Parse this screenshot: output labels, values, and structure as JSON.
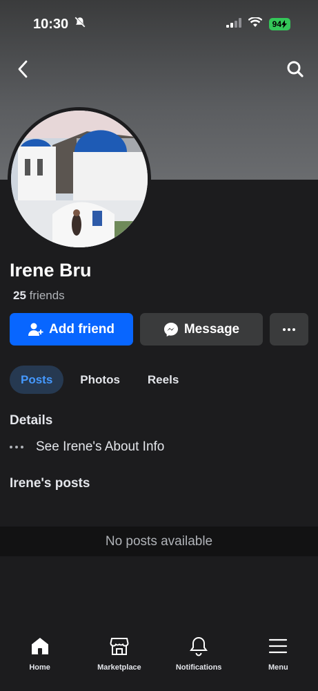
{
  "status_bar": {
    "time": "10:30",
    "battery": "94"
  },
  "profile": {
    "name": "Irene Bru",
    "friends_count": "25",
    "friends_label": "friends"
  },
  "actions": {
    "add_friend": "Add friend",
    "message": "Message"
  },
  "tabs": [
    {
      "label": "Posts",
      "active": true
    },
    {
      "label": "Photos",
      "active": false
    },
    {
      "label": "Reels",
      "active": false
    }
  ],
  "details": {
    "title": "Details",
    "about_link": "See Irene's About Info"
  },
  "posts": {
    "title": "Irene's posts",
    "empty_message": "No posts available"
  },
  "bottom_nav": [
    {
      "label": "Home",
      "icon": "home-icon"
    },
    {
      "label": "Marketplace",
      "icon": "marketplace-icon"
    },
    {
      "label": "Notifications",
      "icon": "bell-icon"
    },
    {
      "label": "Menu",
      "icon": "menu-icon"
    }
  ],
  "colors": {
    "accent": "#0866ff",
    "background": "#1c1c1e",
    "active_tab_text": "#4599ff"
  }
}
